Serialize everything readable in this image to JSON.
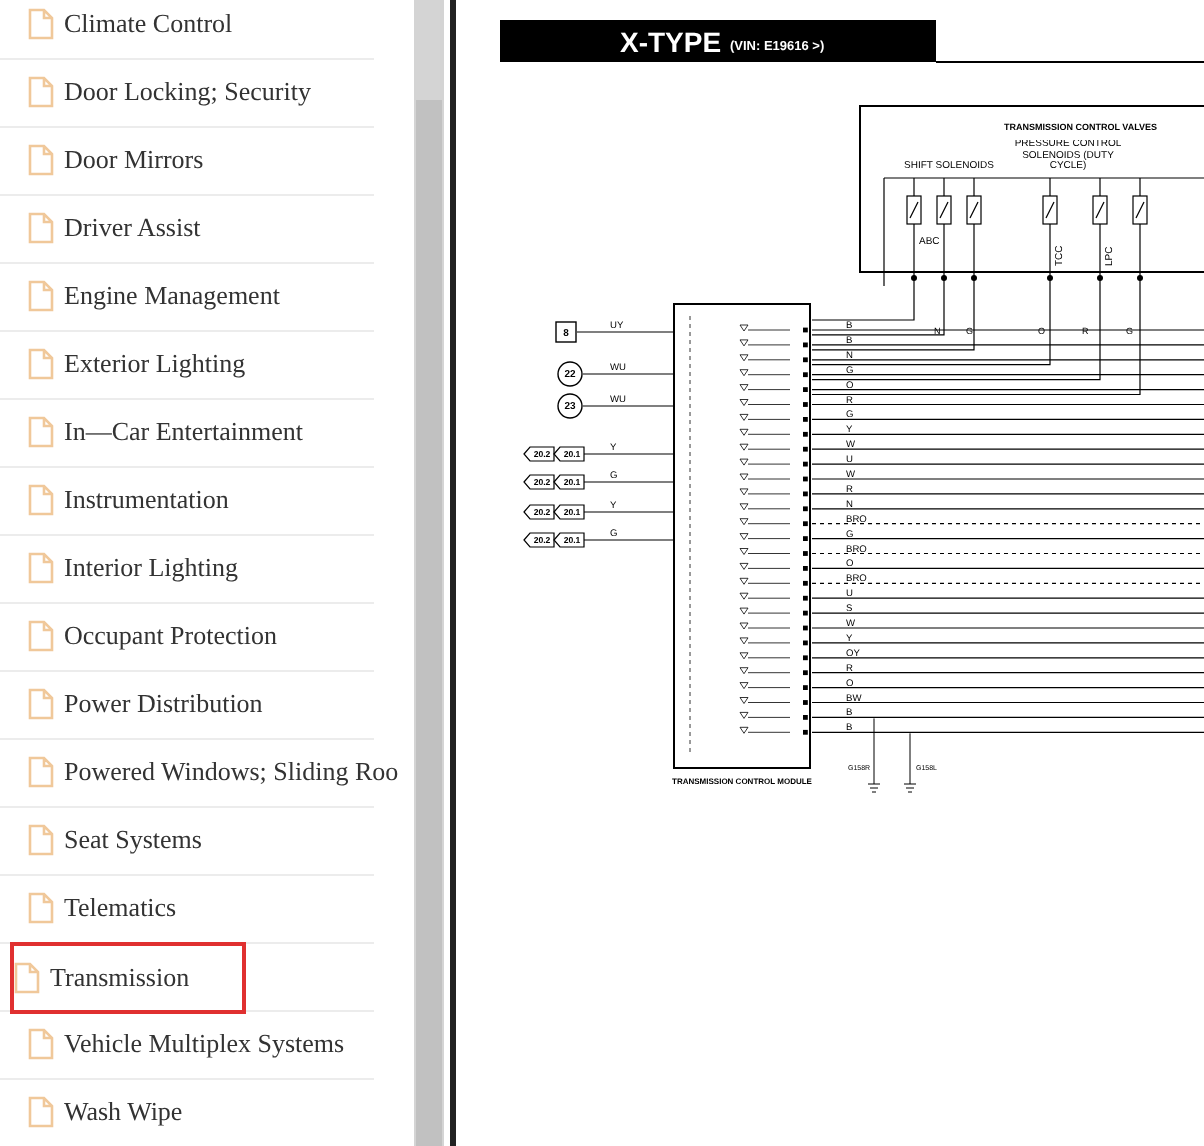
{
  "sidebar": {
    "items": [
      {
        "label": "Climate Control",
        "selected": false
      },
      {
        "label": "Door Locking; Security",
        "selected": false
      },
      {
        "label": "Door Mirrors",
        "selected": false
      },
      {
        "label": "Driver Assist",
        "selected": false
      },
      {
        "label": "Engine Management",
        "selected": false
      },
      {
        "label": "Exterior Lighting",
        "selected": false
      },
      {
        "label": "In—Car Entertainment",
        "selected": false
      },
      {
        "label": "Instrumentation",
        "selected": false
      },
      {
        "label": "Interior Lighting",
        "selected": false
      },
      {
        "label": "Occupant Protection",
        "selected": false
      },
      {
        "label": "Power Distribution",
        "selected": false
      },
      {
        "label": "Powered Windows; Sliding Roo",
        "selected": false
      },
      {
        "label": "Seat Systems",
        "selected": false
      },
      {
        "label": "Telematics",
        "selected": false
      },
      {
        "label": "Transmission",
        "selected": true
      },
      {
        "label": "Vehicle Multiplex Systems",
        "selected": false
      },
      {
        "label": "Wash Wipe",
        "selected": false
      }
    ]
  },
  "diagram": {
    "model": "X-TYPE",
    "vin": "(VIN: E19616 >)",
    "valves_title": "TRANSMISSION CONTROL VALVES",
    "shift_label": "SHIFT SOLENOIDS",
    "pressure_label": "PRESSURE CONTROL SOLENOIDS (DUTY CYCLE)",
    "solenoid_labels": [
      "ABC",
      "TCC",
      "LPC"
    ],
    "valve_wires": [
      "N",
      "G",
      "O",
      "R",
      "G"
    ],
    "module_label": "TRANSMISSION CONTROL MODULE",
    "inputs": [
      {
        "kind": "box",
        "refs": [
          "8"
        ],
        "wire": "UY"
      },
      {
        "kind": "circle",
        "refs": [
          "22"
        ],
        "wire": "WU"
      },
      {
        "kind": "circle",
        "refs": [
          "23"
        ],
        "wire": "WU"
      },
      {
        "kind": "arrow",
        "refs": [
          "20.2",
          "20.1"
        ],
        "wire": "Y"
      },
      {
        "kind": "arrow",
        "refs": [
          "20.2",
          "20.1"
        ],
        "wire": "G"
      },
      {
        "kind": "arrow",
        "refs": [
          "20.2",
          "20.1"
        ],
        "wire": "Y"
      },
      {
        "kind": "arrow",
        "refs": [
          "20.2",
          "20.1"
        ],
        "wire": "G"
      }
    ],
    "output_wires": [
      {
        "label": "B",
        "dashed": false
      },
      {
        "label": "B",
        "dashed": false
      },
      {
        "label": "N",
        "dashed": false
      },
      {
        "label": "G",
        "dashed": false
      },
      {
        "label": "O",
        "dashed": false
      },
      {
        "label": "R",
        "dashed": false
      },
      {
        "label": "G",
        "dashed": false
      },
      {
        "label": "Y",
        "dashed": false
      },
      {
        "label": "W",
        "dashed": false
      },
      {
        "label": "U",
        "dashed": false
      },
      {
        "label": "W",
        "dashed": false
      },
      {
        "label": "R",
        "dashed": false
      },
      {
        "label": "N",
        "dashed": false
      },
      {
        "label": "BRO",
        "dashed": true
      },
      {
        "label": "G",
        "dashed": false
      },
      {
        "label": "BRO",
        "dashed": true
      },
      {
        "label": "O",
        "dashed": false
      },
      {
        "label": "BRO",
        "dashed": true
      },
      {
        "label": "U",
        "dashed": false
      },
      {
        "label": "S",
        "dashed": false
      },
      {
        "label": "W",
        "dashed": false
      },
      {
        "label": "Y",
        "dashed": false
      },
      {
        "label": "OY",
        "dashed": false
      },
      {
        "label": "R",
        "dashed": false
      },
      {
        "label": "O",
        "dashed": false
      },
      {
        "label": "BW",
        "dashed": false
      },
      {
        "label": "B",
        "dashed": false
      },
      {
        "label": "B",
        "dashed": false
      }
    ],
    "grounds": [
      "G158R",
      "G158L"
    ]
  }
}
